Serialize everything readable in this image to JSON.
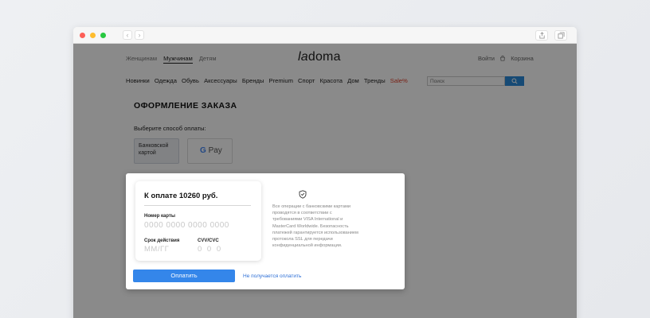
{
  "header": {
    "gender_tabs": [
      "Женщинам",
      "Мужчинам",
      "Детям"
    ],
    "logo": {
      "part1": "la",
      "part2": "doma"
    },
    "login": "Войти",
    "cart": "Корзина"
  },
  "catnav": [
    "Новинки",
    "Одежда",
    "Обувь",
    "Аксессуары",
    "Бренды",
    "Premium",
    "Спорт",
    "Красота",
    "Дом",
    "Тренды",
    "Sale%"
  ],
  "search": {
    "placeholder": "Поиск"
  },
  "order": {
    "title": "ОФОРМЛЕНИЕ ЗАКАЗА",
    "choose_payment": "Выберите способ оплаты:",
    "bank_card": "Банковской картой",
    "gpay": {
      "g": "G",
      "pay": "Pay"
    }
  },
  "modal": {
    "amount": "К оплате 10260 руб.",
    "card_number_label": "Номер карты",
    "card_number_placeholder": "0000 0000 0000 0000",
    "expiry_label": "Срок действия",
    "expiry_placeholder": "ММ/ГГ",
    "cvv_label": "CVV/CVC",
    "cvv_placeholder": "0 0 0",
    "security_text": "Все операции с банковскими картами проводятся в соответствии с требованиями VISA International и MasterCard Worldwide. Безопасность платежей гарантируется использованием протокола SSL для передачи конфиденциальной информации.",
    "pay_button": "Оплатить",
    "fail_link": "Не получается оплатить"
  },
  "colors": {
    "accent": "#3486ea",
    "sale": "#e0402c"
  }
}
